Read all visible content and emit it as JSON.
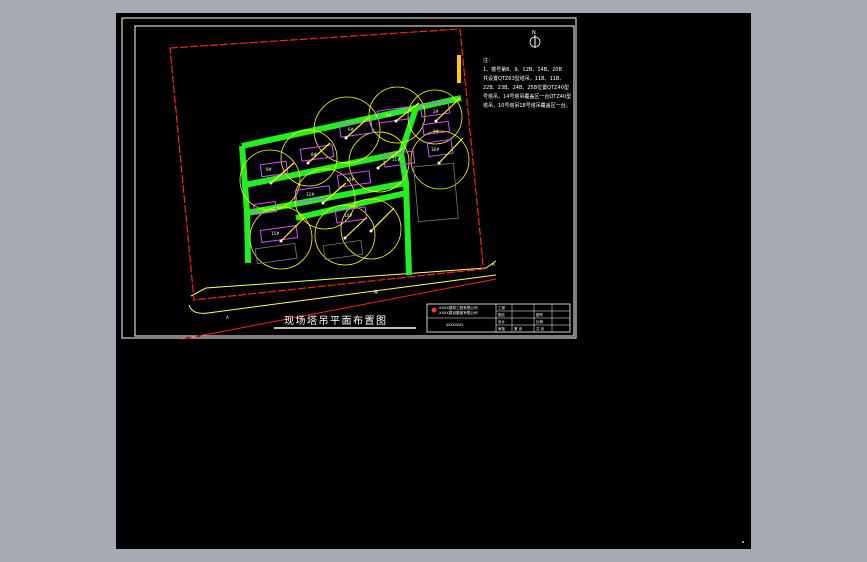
{
  "drawing": {
    "title": "现场塔吊平面布置图",
    "notes": [
      "注：",
      "1、楼号第8、9、12B、14B、20B",
      "共设置QTZ63型塔吊，11B、11B、",
      "22B、23B、24B、25B位置QTZ40型",
      "号塔吊，14号塔吊覆盖区一台QTZ40型",
      "塔吊，10号塔吊18号塔吊覆盖区一台。"
    ],
    "title_block": {
      "company_line1": "XXXX建筑工程有限公司",
      "company_line2": "XXXX建设集团有限公司",
      "project": "XXXXXXXX",
      "cells": [
        "工程",
        "图名",
        "设计",
        "审核",
        "日期",
        "图号",
        "比例",
        "共 页"
      ],
      "sheet": "第  页"
    },
    "north_label": "N",
    "road_label_left": "A",
    "road_label_mid": "路",
    "road_label_right": "A",
    "building_labels": [
      "2#",
      "3#",
      "5#",
      "6#",
      "8#",
      "9#",
      "10#",
      "11#",
      "12#",
      "14#",
      "15#",
      "16#"
    ],
    "crane_labels": [
      "QTZ63",
      "QTZ40"
    ]
  },
  "colors": {
    "background": "#000000",
    "frame": "#ffffff",
    "site_boundary": "#ff2020",
    "crane_radius": "#ffff00",
    "road": "#22ee22",
    "building": "#d050ff",
    "street": "#ffff66"
  }
}
